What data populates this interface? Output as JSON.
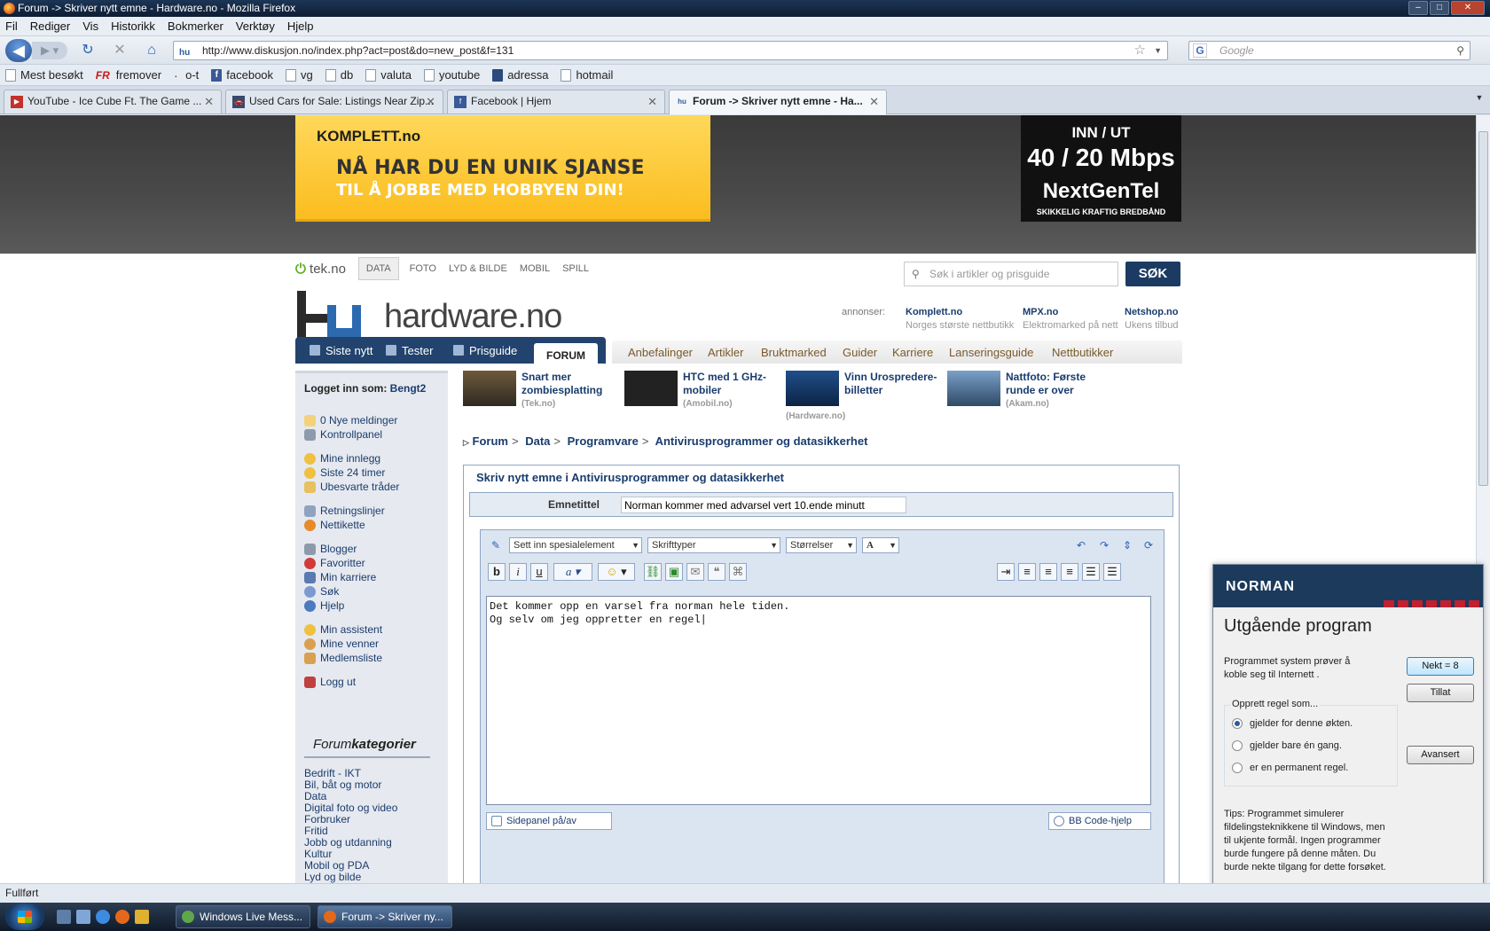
{
  "window": {
    "title": "Forum -> Skriver nytt emne - Hardware.no - Mozilla Firefox"
  },
  "menu": [
    "Fil",
    "Rediger",
    "Vis",
    "Historikk",
    "Bokmerker",
    "Verktøy",
    "Hjelp"
  ],
  "url": "http://www.diskusjon.no/index.php?act=post&do=new_post&f=131",
  "browser_search": {
    "placeholder": "Google"
  },
  "bookmarks": [
    "Mest besøkt",
    "fremover",
    "o-t",
    "facebook",
    "vg",
    "db",
    "valuta",
    "youtube",
    "adressa",
    "hotmail"
  ],
  "tabs": [
    {
      "label": "YouTube - Ice Cube Ft. The Game ...",
      "active": false
    },
    {
      "label": "Used Cars for Sale: Listings Near Zip...",
      "active": false
    },
    {
      "label": "Facebook | Hjem",
      "active": false
    },
    {
      "label": "Forum -> Skriver nytt emne - Ha...",
      "active": true
    }
  ],
  "ads": {
    "komplett": {
      "brand": "KOMPLETT.no",
      "line1": "NÅ HAR DU EN UNIK SJANSE",
      "line2": "TIL Å JOBBE MED HOBBYEN DIN!"
    },
    "nextgentel": {
      "line1": "INN / UT",
      "line2": "40 / 20 Mbps",
      "brand": "NextGenTel",
      "tagline": "SKIKKELIG KRAFTIG BREDBÅND"
    }
  },
  "teknav": {
    "logo": "tek.no",
    "items": [
      "DATA",
      "FOTO",
      "LYD & BILDE",
      "MOBIL",
      "SPILL"
    ]
  },
  "site_search": {
    "placeholder": "Søk i artikler og prisguide",
    "button": "SØK"
  },
  "logo_text": "hardware.no",
  "advertisers": {
    "label": "annonser:",
    "shops": [
      {
        "name": "Komplett.no",
        "desc": "Norges største nettbutikk"
      },
      {
        "name": "MPX.no",
        "desc": "Elektromarked på nett"
      },
      {
        "name": "Netshop.no",
        "desc": "Ukens tilbud"
      }
    ]
  },
  "main_nav": {
    "dark": [
      "Siste nytt",
      "Tester",
      "Prisguide"
    ],
    "active": "FORUM",
    "light": [
      "Anbefalinger",
      "Artikler",
      "Bruktmarked",
      "Guider",
      "Karriere",
      "Lanseringsguide",
      "Nettbutikker"
    ]
  },
  "sidebar": {
    "login_label": "Logget inn som:",
    "user": "Bengt2",
    "links": [
      "0 Nye meldinger",
      "Kontrollpanel",
      "Mine innlegg",
      "Siste 24 timer",
      "Ubesvarte tråder",
      "Retningslinjer",
      "Nettikette",
      "Blogger",
      "Favoritter",
      "Min karriere",
      "Søk",
      "Hjelp",
      "Min assistent",
      "Mine venner",
      "Medlemsliste",
      "Logg ut"
    ],
    "categories_title_a": "Forum",
    "categories_title_b": "kategorier",
    "categories": [
      "Bedrift - IKT",
      "Bil, båt og motor",
      "Data",
      "Digital foto og video",
      "Forbruker",
      "Fritid",
      "Jobb og utdanning",
      "Kultur",
      "Mobil og PDA",
      "Lyd og bilde"
    ]
  },
  "teasers": [
    {
      "title": "Snart mer zombiesplatting",
      "source": "(Tek.no)"
    },
    {
      "title": "HTC med 1 GHz-mobiler",
      "source": "(Amobil.no)"
    },
    {
      "title": "Vinn Urospredere-billetter",
      "source": "(Hardware.no)"
    },
    {
      "title": "Nattfoto: Første runde er over",
      "source": "(Akam.no)"
    }
  ],
  "breadcrumb": [
    "Forum",
    "Data",
    "Programvare",
    "Antivirusprogrammer og datasikkerhet"
  ],
  "post": {
    "heading": "Skriv nytt emne i Antivirusprogrammer og datasikkerhet",
    "subject_label": "Emnetittel",
    "subject_value": "Norman kommer med advarsel vert 10.ende minutt",
    "special_select": "Sett inn spesialelement",
    "font_select": "Skrifttyper",
    "size_select": "Størrelser",
    "body": "Det kommer opp en varsel fra norman hele tiden.\nOg selv om jeg oppretter en regel|",
    "sidepanel": "Sidepanel på/av",
    "bbcode": "BB Code-hjelp"
  },
  "norman": {
    "brand": "NORMAN",
    "title": "Utgående program",
    "message": "Programmet system prøver å koble seg til Internett .",
    "deny": "Nekt = 8",
    "allow": "Tillat",
    "advanced": "Avansert",
    "rule_legend": "Opprett regel som...",
    "options": [
      "gjelder for denne økten.",
      "gjelder bare én gang.",
      "er en permanent regel."
    ],
    "tips": "Tips: Programmet simulerer fildelingsteknikkene til Windows, men til ukjente formål. Ingen programmer burde fungere på denne måten. Du burde nekte tilgang for dette forsøket."
  },
  "status": "Fullført",
  "taskbar": [
    "Windows Live Mess...",
    "Forum -> Skriver ny..."
  ]
}
